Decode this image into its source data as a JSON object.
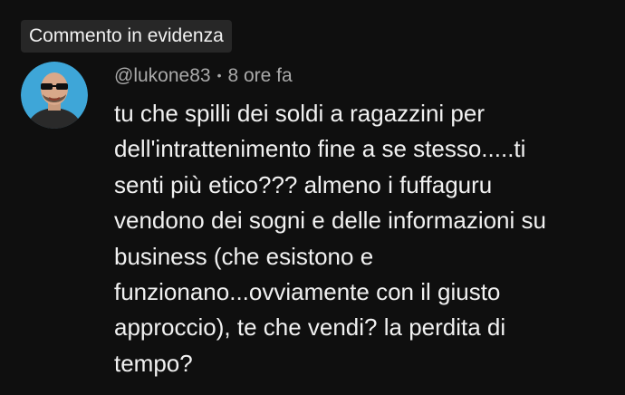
{
  "pinned_label": "Commento in evidenza",
  "comment": {
    "author": "@lukone83",
    "separator": "•",
    "time": "8 ore fa",
    "text": "tu che spilli dei soldi a ragazzini per dell'intrattenimento fine a se stesso.....ti senti più etico??? almeno i fuffaguru vendono dei sogni e delle informazioni su business (che esistono e funzionano...ovviamente con il giusto approccio), te che vendi? la perdita di tempo?"
  },
  "colors": {
    "background": "#0f0f0f",
    "badge_bg": "#272727",
    "text_primary": "#f1f1f1",
    "text_secondary": "#aaaaaa",
    "avatar_bg": "#3ea6d8"
  }
}
